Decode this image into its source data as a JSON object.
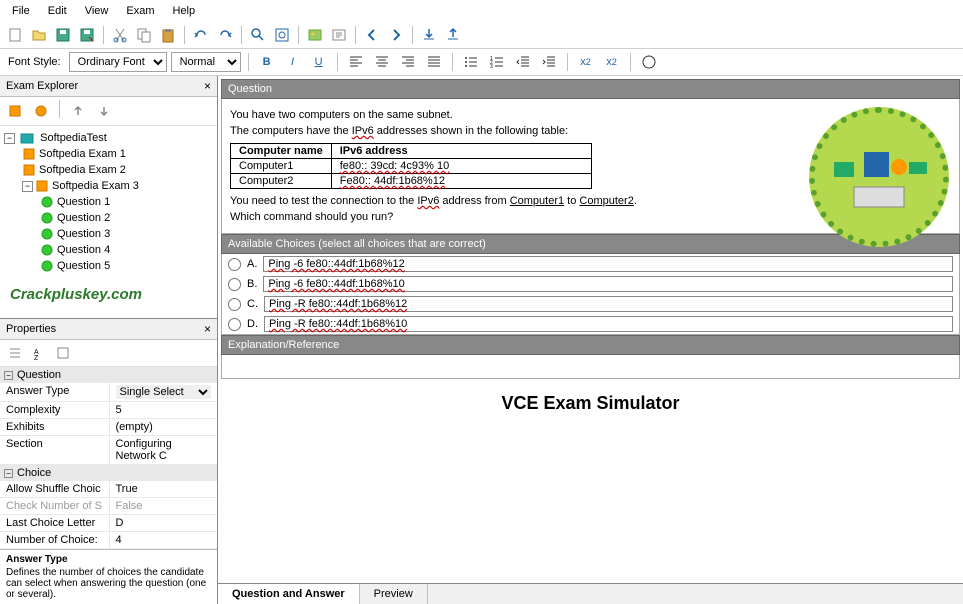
{
  "menu": [
    "File",
    "Edit",
    "View",
    "Exam",
    "Help"
  ],
  "format_bar": {
    "font_style_label": "Font Style:",
    "font_style_value": "Ordinary Font",
    "font_size_value": "Normal"
  },
  "explorer": {
    "title": "Exam Explorer",
    "root": "SoftpediaTest",
    "exams": [
      "Softpedia Exam 1",
      "Softpedia Exam 2",
      "Softpedia Exam 3"
    ],
    "questions": [
      "Question 1",
      "Question 2",
      "Question 3",
      "Question 4",
      "Question 5"
    ]
  },
  "watermark": "Crackpluskey.com",
  "properties": {
    "title": "Properties",
    "sections": {
      "question": {
        "label": "Question",
        "rows": [
          {
            "k": "Answer Type",
            "v": "Single Select"
          },
          {
            "k": "Complexity",
            "v": "5"
          },
          {
            "k": "Exhibits",
            "v": "(empty)"
          },
          {
            "k": "Section",
            "v": "Configuring Network C"
          }
        ]
      },
      "choice": {
        "label": "Choice",
        "rows": [
          {
            "k": "Allow Shuffle Choic",
            "v": "True"
          },
          {
            "k": "Check Number of S",
            "v": "False",
            "disabled": true
          },
          {
            "k": "Last Choice Letter",
            "v": "D"
          },
          {
            "k": "Number of Choice:",
            "v": "4"
          }
        ]
      }
    },
    "help": {
      "title": "Answer Type",
      "text": "Defines the number of choices the candidate can select when answering the question (one or several)."
    }
  },
  "question": {
    "header": "Question",
    "line1": "You have two computers on the same subnet.",
    "line2_a": "The computers have the ",
    "line2_b": "IPv6",
    "line2_c": " addresses shown in the following table:",
    "table": {
      "headers": [
        "Computer name",
        "IPv6 address"
      ],
      "rows": [
        [
          "Computer1",
          "fe80:: 39cd: 4c93% 10"
        ],
        [
          "Computer2",
          "Fe80:: 44df:1b68%12"
        ]
      ]
    },
    "line3_a": "You need to test the connection to the ",
    "line3_b": "IPv6",
    "line3_c": " address from ",
    "line3_d": "Computer1",
    "line3_e": " to ",
    "line3_f": "Computer2",
    "line3_g": ".",
    "line4": "Which command should you run?"
  },
  "choices": {
    "header": "Available Choices (select all choices that are correct)",
    "items": [
      {
        "letter": "A.",
        "text": "Ping -6 fe80::44df:1b68%12"
      },
      {
        "letter": "B.",
        "text": "Ping -6 fe80::44df:1b68%10"
      },
      {
        "letter": "C.",
        "text": "Ping -R fe80::44df:1b68%12"
      },
      {
        "letter": "D.",
        "text": "Ping -R fe80::44df:1b68%10"
      }
    ]
  },
  "explanation": {
    "header": "Explanation/Reference"
  },
  "brand": "VCE Exam Simulator",
  "tabs": [
    "Question and Answer",
    "Preview"
  ]
}
